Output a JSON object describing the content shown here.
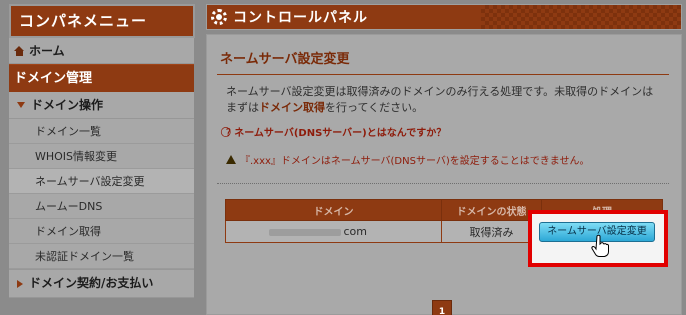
{
  "sidebar": {
    "title": "コンパネメニュー",
    "home": "ホーム",
    "domain_section": "ドメイン管理",
    "domain_ops": "ドメイン操作",
    "items": [
      {
        "label": "ドメイン一覧"
      },
      {
        "label": "WHOIS情報変更"
      },
      {
        "label": "ネームサーバ設定変更",
        "active": true
      },
      {
        "label": "ムームーDNS"
      },
      {
        "label": "ドメイン取得"
      },
      {
        "label": "未認証ドメイン一覧"
      }
    ],
    "contract": "ドメイン契約/お支払い"
  },
  "header": {
    "title": "コントロールパネル"
  },
  "content": {
    "title": "ネームサーバ設定変更",
    "desc_1": "ネームサーバ設定変更は取得済みのドメインのみ行える処理です。未取得のドメインは",
    "desc_2a": "まずは",
    "desc_2b": "ドメイン取得",
    "desc_2c": "を行ってください。",
    "help_link": "ネームサーバ(DNSサーバー)とはなんですか？",
    "warning": "『.xxx』ドメインはネームサーバ(DNSサーバ)を設定することはできません。"
  },
  "table": {
    "headers": [
      "ドメイン",
      "ドメインの状態",
      "処理"
    ],
    "rows": [
      {
        "domain": "com",
        "status": "取得済み",
        "action": "ネームサーバ設定変更"
      }
    ]
  },
  "pagination": {
    "current": "1"
  },
  "colors": {
    "brand": "#8e3a12",
    "highlight": "#e10000",
    "button": "#2da8d6"
  }
}
